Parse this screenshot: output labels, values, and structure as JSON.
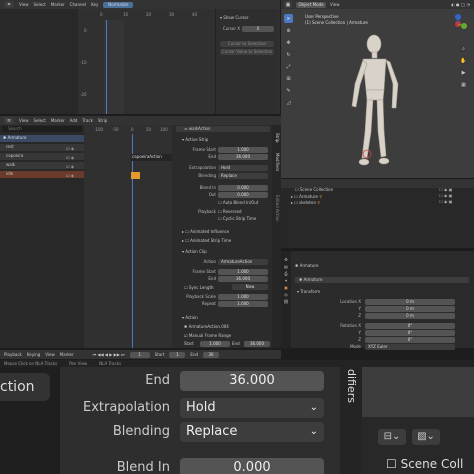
{
  "graph_editor": {
    "menus": [
      "View",
      "Select",
      "Marker",
      "Channel",
      "Key"
    ],
    "mode": "Normalize",
    "frame_ticks": [
      "0",
      "10",
      "20",
      "30",
      "40"
    ],
    "value_ticks": [
      "0",
      "-10",
      "-20"
    ],
    "show_cursor_title": "Show Cursor",
    "cursor_x_label": "Cursor X",
    "cursor_x_value": "0",
    "cursor_to_selection": "Cursor to Selection",
    "cursor_value_to_selection": "Cursor Value to Selection"
  },
  "viewport": {
    "mode": "Object Mode",
    "menus": [
      "View"
    ],
    "perspective": "User Perspective",
    "collection_path": "(1) Scene Collection | Armature"
  },
  "outliner": {
    "title": "Scene Collection",
    "items": [
      "Armature",
      "skeleton"
    ]
  },
  "nla": {
    "menus": [
      "View",
      "Select",
      "Marker",
      "Add",
      "Track",
      "Strip"
    ],
    "search_placeholder": "Search",
    "frame_ticks": [
      "-100",
      "-50",
      "0",
      "50",
      "100"
    ],
    "tracks": [
      "Armature",
      "rest",
      "capoeira",
      "walk",
      "idle"
    ],
    "strip_label": "capoeiraAction",
    "action_label": "walkAction"
  },
  "sidebar": {
    "tabs": [
      "Strip",
      "Modifiers",
      "Edited Action"
    ],
    "header_action": "walkAction",
    "active_strip_title": "Active Strip",
    "frame_start_label": "Frame Start",
    "frame_start_value": "1.000",
    "end_label": "End",
    "end_value": "36.000",
    "extrapolation_label": "Extrapolation",
    "extrapolation_value": "Hold",
    "blending_label": "Blending",
    "blending_value": "Replace",
    "blend_in_label": "Blend In",
    "blend_in_value": "0.000",
    "out_label": "Out",
    "out_value": "0.000",
    "auto_blend": "Auto Blend In/Out",
    "playback_label": "Playback",
    "reversed": "Reversed",
    "cyclic_strip_time": "Cyclic Strip Time",
    "animated_influence": "Animated Influence",
    "animated_strip_time": "Animated Strip Time",
    "action_clip_title": "Action Clip",
    "action_label": "Action",
    "action_value": "ArmatureAction",
    "clip_frame_start_value": "1.000",
    "clip_end_value": "36.000",
    "sync_length": "Sync Length",
    "now_button": "Now",
    "playback_scale_label": "Playback Scale",
    "playback_scale_value": "1.000",
    "repeat_label": "Repeat",
    "repeat_value": "1.000",
    "action_section_title": "Action",
    "action_name": "ArmatureAction.004",
    "manual_frame_range": "Manual Frame Range",
    "start_label": "Start",
    "start_value": "1.000",
    "range_end_value": "36.000"
  },
  "properties": {
    "object_name": "Armature",
    "object_name_2": "Armature",
    "transform_title": "Transform",
    "location_x_label": "Location X",
    "rotation_x_label": "Rotation X",
    "mode_label": "Mode",
    "mode_value": "XYZ Euler",
    "y_label": "Y",
    "z_label": "Z",
    "loc_values": [
      "0 m",
      "0 m",
      "0 m"
    ],
    "rot_values": [
      "0°",
      "0°",
      "0°"
    ]
  },
  "timeline": {
    "playback": "Playback",
    "keying": "Keying",
    "view": "View",
    "marker": "Marker",
    "current_frame": "1",
    "start_label": "Start",
    "start_value": "1",
    "end_label": "End",
    "end_value": "36"
  },
  "status_bar": {
    "item1": "Mouse Click on NLA Tracks",
    "item2": "Pan View",
    "item3": "NLA Tracks"
  },
  "zoom": {
    "end_label": "End",
    "end_value": "36.000",
    "extrapolation_label": "Extrapolation",
    "extrapolation_value": "Hold",
    "blending_label": "Blending",
    "blending_value": "Replace",
    "blend_in_label": "Blend In",
    "blend_in_value": "0.000",
    "left_tab_text": "ction",
    "modifiers_tab": "difiers",
    "scene_coll_text": "Scene Coll"
  }
}
